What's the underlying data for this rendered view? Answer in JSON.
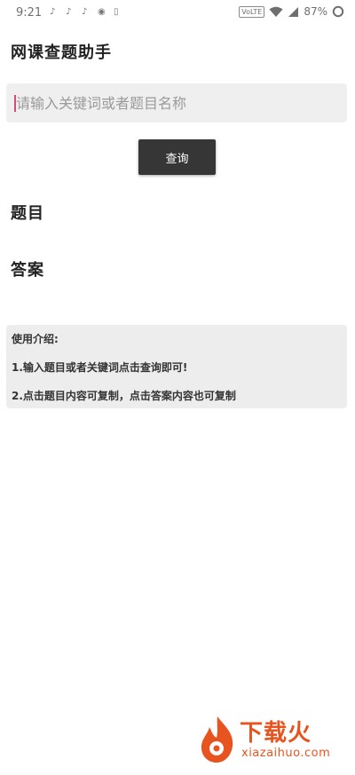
{
  "status_bar": {
    "time": "9:21",
    "network_badge": "VoLTE",
    "battery_percent": "87%"
  },
  "app": {
    "title": "网课查题助手"
  },
  "search": {
    "placeholder": "请输入关键词或者题目名称",
    "value": "",
    "button_label": "查询"
  },
  "sections": {
    "question_label": "题目",
    "answer_label": "答案"
  },
  "instructions": {
    "heading": "使用介绍:",
    "line_1": "1.输入题目或者关键词点击查询即可!",
    "line_2": "2.点击题目内容可复制，点击答案内容也可复制"
  },
  "watermark": {
    "brand_cn": "下载火",
    "brand_en": "xiazaihuo.com"
  },
  "colors": {
    "button_bg": "#363636",
    "input_bg": "#efefef",
    "caret": "#d64a7a",
    "watermark": "#e8541f"
  }
}
